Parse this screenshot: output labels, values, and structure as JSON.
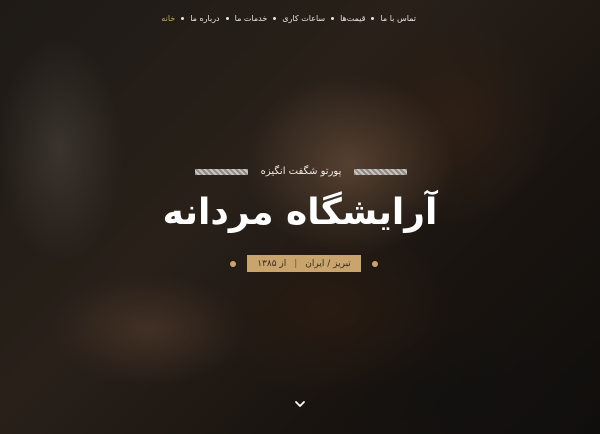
{
  "nav": {
    "items": [
      {
        "label": "خانه",
        "active": true
      },
      {
        "label": "درباره ما",
        "active": false
      },
      {
        "label": "خدمات ما",
        "active": false
      },
      {
        "label": "ساعات کاری",
        "active": false
      },
      {
        "label": "قیمت‌ها",
        "active": false
      },
      {
        "label": "تماس با ما",
        "active": false
      }
    ]
  },
  "hero": {
    "subtitle": "پورتو شگفت انگیزه",
    "title": "آرایشگاه مردانه",
    "location": "تبریز / ایران",
    "since": "از ۱۳۸۵",
    "scroll_icon": "chevron-down-icon"
  },
  "colors": {
    "accent": "#c9a46c",
    "text": "#ffffff"
  }
}
